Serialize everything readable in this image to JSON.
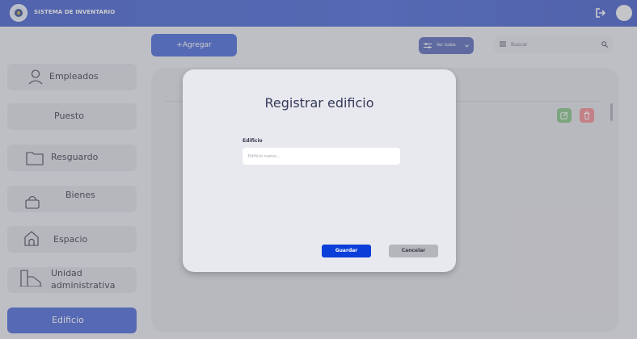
{
  "header": {
    "app_title": "SISTEMA DE INVENTARIO"
  },
  "sidebar": {
    "items": [
      {
        "label": "Empleados",
        "icon": "user-icon"
      },
      {
        "label": "Puesto",
        "icon": ""
      },
      {
        "label": "Resguardo",
        "icon": "folder-icon"
      },
      {
        "label": "Bienes",
        "icon": "bag-icon"
      },
      {
        "label": "Espacio",
        "icon": "house-icon"
      },
      {
        "label_line1": "Unidad",
        "label_line2": "administrativa",
        "icon": "buildings-icon"
      },
      {
        "label": "Edificio",
        "icon": "",
        "active": true
      }
    ]
  },
  "toolbar": {
    "add_label": "+Agregar",
    "filter_label": "Ver todos",
    "search_placeholder": "Buscar"
  },
  "modal": {
    "title": "Registrar edificio",
    "field_label": "Edificio",
    "field_placeholder": "Edificio nuevo...",
    "field_value": "",
    "save_label": "Guardar",
    "cancel_label": "Cancelar"
  },
  "colors": {
    "header": "#3f5fd3",
    "primary_button": "#4062d6",
    "save_button": "#0b3ed8",
    "cancel_button": "#b5b6bc",
    "edit_button": "#7ec07f",
    "delete_button": "#f0878b"
  }
}
